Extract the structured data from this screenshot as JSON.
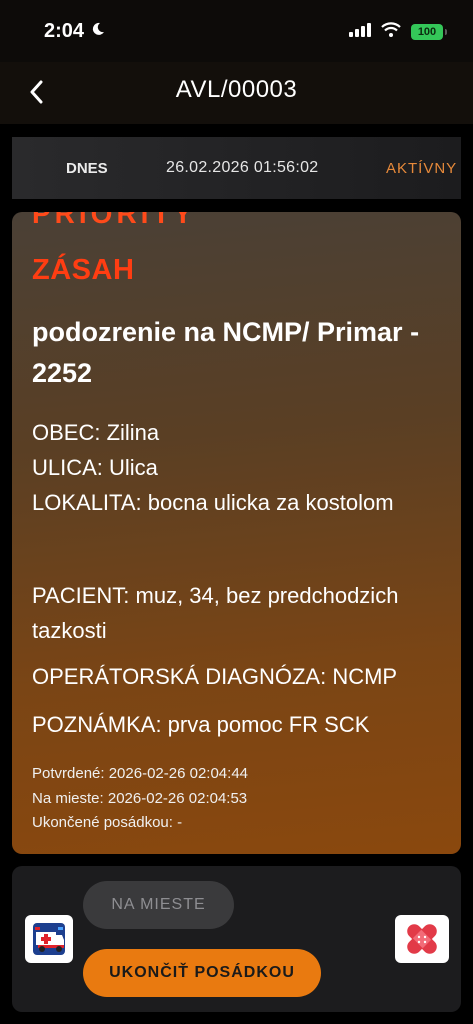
{
  "status_bar": {
    "time": "2:04",
    "battery": "100"
  },
  "header": {
    "title": "AVL/00003"
  },
  "info_strip": {
    "day": "DNES",
    "datetime": "26.02.2026  01:56:02",
    "status": "AKTÍVNY"
  },
  "card": {
    "partial_heading": "PRIORITY",
    "type": "ZÁSAH",
    "title": "podozrenie na NCMP/ Primar - 2252",
    "obec": "OBEC: Zilina",
    "ulica": "ULICA: Ulica",
    "lokalita": "LOKALITA: bocna ulicka za kostolom",
    "pacient": "PACIENT: muz, 34, bez predchodzich tazkosti",
    "diagnoza": "OPERÁTORSKÁ DIAGNÓZA: NCMP",
    "poznamka": "POZNÁMKA: prva pomoc FR SCK",
    "potvrdene": "Potvrdené: 2026-02-26 02:04:44",
    "na_mieste": "Na mieste: 2026-02-26 02:04:53",
    "ukoncene": "Ukončené posádkou: -"
  },
  "actions": {
    "on_site_label": "NA MIESTE",
    "finish_label": "UKONČIŤ POSÁDKOU"
  },
  "colors": {
    "accent": "#e97a10",
    "alert": "#ff3d12",
    "status": "#e6893a"
  }
}
